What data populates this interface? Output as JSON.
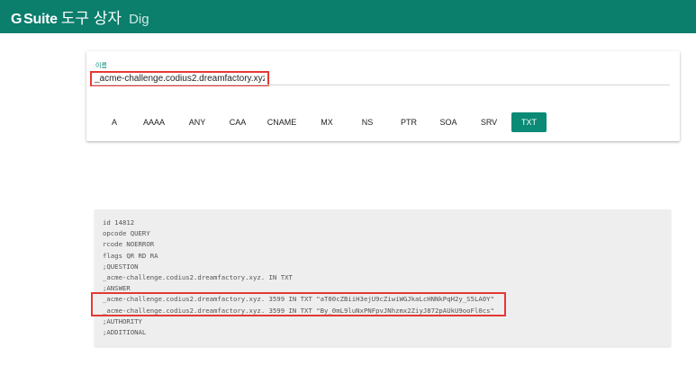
{
  "header": {
    "brand_g": "G",
    "brand_suite": "Suite",
    "brand_tools": "도구 상자",
    "app_name": "Dig"
  },
  "form": {
    "name_label": "이름",
    "name_value": "_acme-challenge.codius2.dreamfactory.xyz"
  },
  "record_types": [
    "A",
    "AAAA",
    "ANY",
    "CAA",
    "CNAME",
    "MX",
    "NS",
    "PTR",
    "SOA",
    "SRV",
    "TXT"
  ],
  "selected_type": "TXT",
  "result": {
    "lines": [
      "id 14812",
      "opcode QUERY",
      "rcode NOERROR",
      "flags QR RD RA",
      ";QUESTION",
      "_acme-challenge.codius2.dreamfactory.xyz. IN TXT",
      ";ANSWER",
      "_acme-challenge.codius2.dreamfactory.xyz. 3599 IN TXT \"aT00cZBiiH3ejU9cZiwiWGJkaLcHNNkPqH2y_S5LA0Y\"",
      "_acme-challenge.codius2.dreamfactory.xyz. 3599 IN TXT \"By_0mL9luNxPNFpvJNhzmx2ZiyJ872pAUkU9ooFl0cs\"",
      ";AUTHORITY",
      ";ADDITIONAL"
    ]
  },
  "colors": {
    "brand": "#0b7e6c",
    "accent": "#0b8a75",
    "highlight": "#e53935"
  }
}
